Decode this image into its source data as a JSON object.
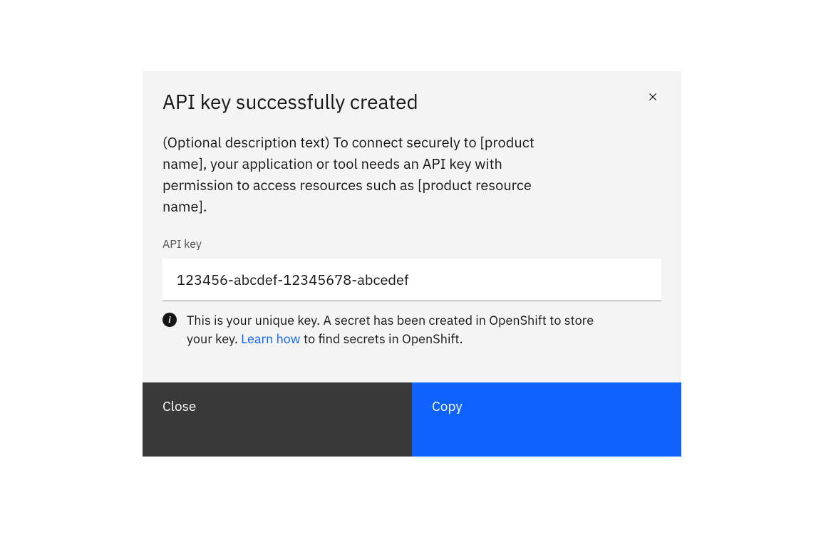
{
  "modal": {
    "title": "API key successfully created",
    "description": "(Optional description text) To connect securely to [product name], your application or tool needs an API key with permission to access resources such as [product resource name].",
    "field": {
      "label": "API key",
      "value": "123456-abcdef-12345678-abcedef"
    },
    "info": {
      "text_before_link": "This is your unique key. A secret has been created in OpenShift to store your key. ",
      "link_text": "Learn how",
      "text_after_link": " to find secrets in OpenShift."
    },
    "buttons": {
      "close": "Close",
      "copy": "Copy"
    }
  }
}
